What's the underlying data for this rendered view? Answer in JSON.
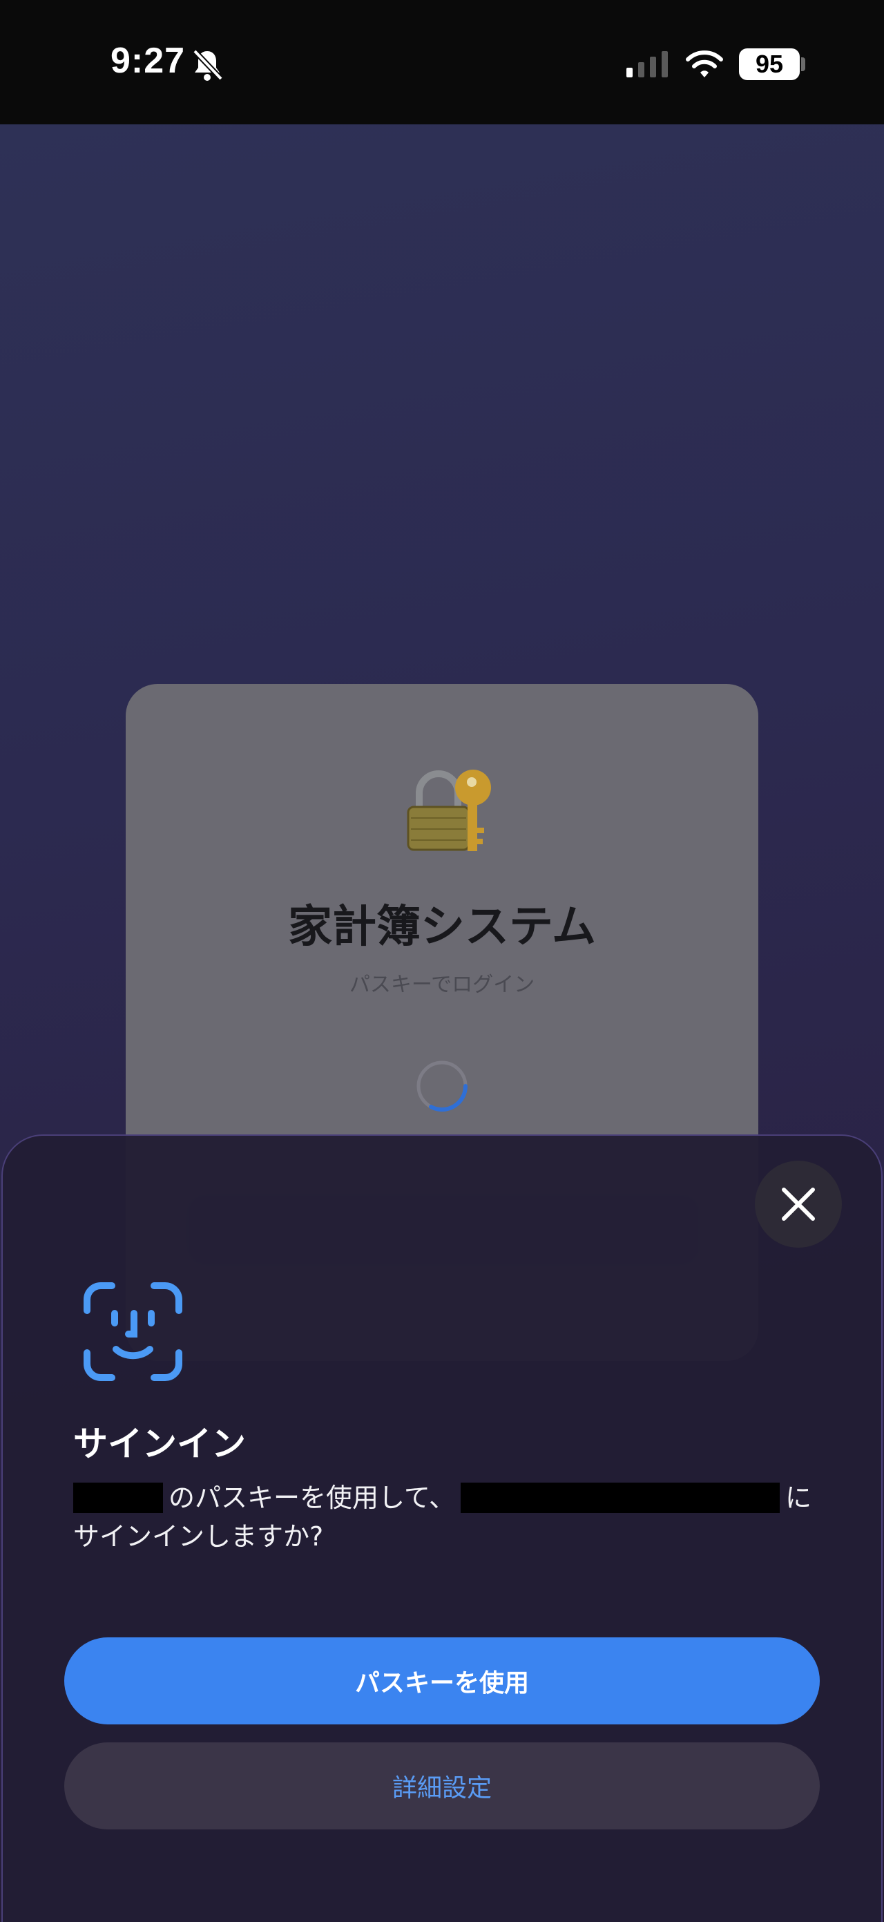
{
  "status_bar": {
    "time": "9:27",
    "battery_level": "95",
    "icons": [
      "bell-slash-icon",
      "cellular-signal-icon",
      "wifi-icon",
      "battery-icon"
    ]
  },
  "login_card": {
    "icon": "lock-with-key-icon",
    "title": "家計簿システム",
    "subtitle": "パスキーでログイン",
    "loading_indicator": "spinner"
  },
  "sheet": {
    "icon": "face-id-icon",
    "title": "サインイン",
    "prompt_part1": "のパスキーを使用して、",
    "prompt_part2": "に",
    "prompt_part3": "サインインしますか?",
    "primary_button": "パスキーを使用",
    "secondary_button": "詳細設定",
    "close_icon": "close-icon"
  },
  "colors": {
    "accent": "#3b84f0",
    "secondary_text": "#5a9cf5",
    "sheet_bg": "#221d34"
  }
}
